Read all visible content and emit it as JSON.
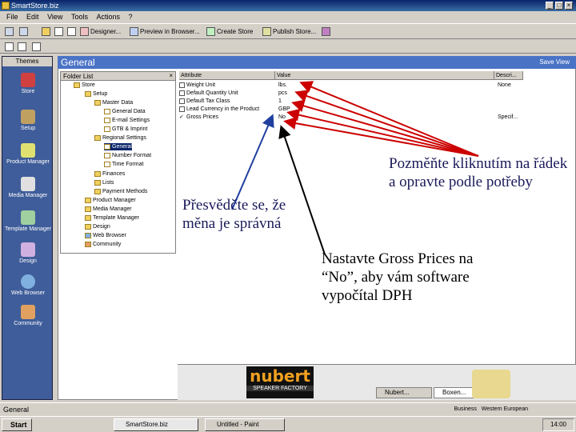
{
  "window": {
    "title": "SmartStore.biz",
    "min": "_",
    "max": "□",
    "close": "×"
  },
  "menu": [
    "File",
    "Edit",
    "View",
    "Tools",
    "Actions",
    "?"
  ],
  "toolbar": {
    "designer": "Designer...",
    "preview": "Preview in Browser...",
    "create_store": "Create Store",
    "publish": "Publish Store..."
  },
  "sidebar": {
    "header": "Themes",
    "items": [
      "Store",
      "Setup",
      "Product Manager",
      "Media Manager",
      "Template Manager",
      "Design",
      "Web Browser",
      "Community"
    ]
  },
  "main": {
    "title": "General",
    "save_view": "Save View"
  },
  "folder_list": {
    "header": "Folder List",
    "nodes": [
      "Store",
      "Setup",
      "Master Data",
      "General Data",
      "E-mail Settings",
      "GTB & Imprint",
      "Regional Settings",
      "General",
      "Number Format",
      "Time Format",
      "Finances",
      "Lists",
      "Payment Methods",
      "Product Manager",
      "Media Manager",
      "Template Manager",
      "Design",
      "Web Browser",
      "Community"
    ]
  },
  "grid": {
    "headers": [
      "Attribute",
      "Value",
      "Descri..."
    ],
    "rows": [
      {
        "attr": "Weight Unit",
        "value": "lbs.",
        "desc": "None"
      },
      {
        "attr": "Default Quantity Unit",
        "value": "pcs",
        "desc": ""
      },
      {
        "attr": "Default Tax Class",
        "value": "1",
        "desc": ""
      },
      {
        "attr": "Lead Currency in the Product",
        "value": "GBP",
        "desc": ""
      },
      {
        "attr": "Gross Prices",
        "value": "No",
        "desc": "Specif..."
      }
    ]
  },
  "banner": {
    "logo": "nubert",
    "tagline": "SPEAKER FACTORY",
    "tab1": "Nubert...",
    "tab2": "Boxen..."
  },
  "status": {
    "text": "General",
    "business": "Business",
    "region": "Western European"
  },
  "taskbar": {
    "start": "Start",
    "tasks": [
      "SmartStore.biz",
      "Untitled - Paint"
    ],
    "clock": "14:00"
  },
  "annotations": {
    "left": "Přesvědčte se, že měna je správná",
    "right": "Pozměňte kliknutím na řádek a opravte podle potřeby",
    "bottom": "Nastavte Gross Prices na “No”, aby vám software vypočítal DPH"
  },
  "colors": {
    "titlebar": "#0a246a",
    "sidebar": "#3f5d9a",
    "header": "#4a73c6",
    "arrow_red": "#cc0000",
    "arrow_blue": "#2040a0"
  }
}
